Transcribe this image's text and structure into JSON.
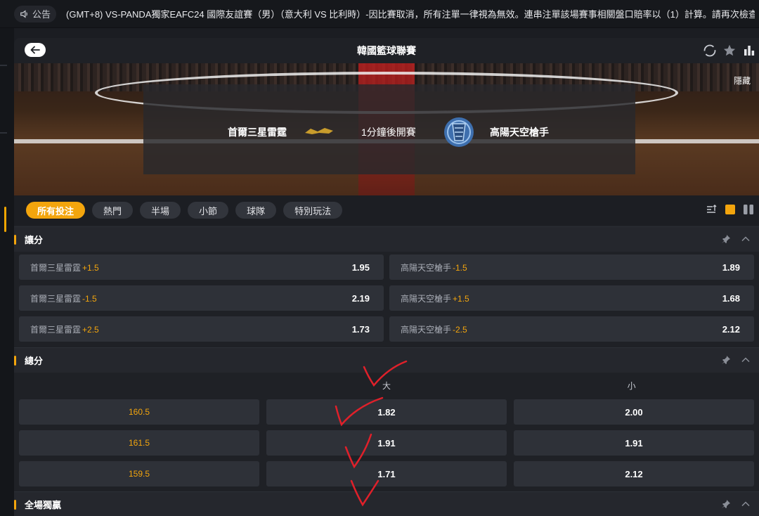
{
  "notice": {
    "label": "公告",
    "text": "(GMT+8) VS-PANDA獨家EAFC24 國際友誼賽（男）（意大利 VS 比利時）-因比賽取消，所有注單一律視為無效。連串注單該場賽事相關盤口賠率以（1）計算。請再次檢查您的注單，造"
  },
  "header": {
    "title": "韓國籃球聯賽"
  },
  "hero": {
    "hide_label": "隱藏",
    "home_team": "首爾三星雷霆",
    "status": "1分鐘後開賽",
    "away_team": "高陽天空槍手"
  },
  "filters": [
    "所有投注",
    "熱門",
    "半場",
    "小節",
    "球隊",
    "特別玩法"
  ],
  "handicap": {
    "title": "讓分",
    "rows": [
      [
        {
          "team": "首爾三星雷霆",
          "line": "+1.5",
          "price": "1.95"
        },
        {
          "team": "高陽天空槍手",
          "line": "-1.5",
          "price": "1.89"
        }
      ],
      [
        {
          "team": "首爾三星雷霆",
          "line": "-1.5",
          "price": "2.19"
        },
        {
          "team": "高陽天空槍手",
          "line": "+1.5",
          "price": "1.68"
        }
      ],
      [
        {
          "team": "首爾三星雷霆",
          "line": "+2.5",
          "price": "1.73"
        },
        {
          "team": "高陽天空槍手",
          "line": "-2.5",
          "price": "2.12"
        }
      ]
    ]
  },
  "totals": {
    "title": "總分",
    "over_label": "大",
    "under_label": "小",
    "rows": [
      {
        "line": "160.5",
        "over": "1.82",
        "under": "2.00"
      },
      {
        "line": "161.5",
        "over": "1.91",
        "under": "1.91"
      },
      {
        "line": "159.5",
        "over": "1.71",
        "under": "2.12"
      }
    ]
  },
  "moneyline": {
    "title": "全場獨贏"
  },
  "colors": {
    "accent": "#f3a50d",
    "annotation": "#e0202a"
  },
  "icons": {
    "notice": "speaker-icon",
    "back": "arrow-left-icon",
    "refresh": "refresh-icon",
    "favorite": "star-icon",
    "stats": "bar-chart-icon",
    "collapse": "chevron-up-icon",
    "pin": "pin-icon"
  }
}
